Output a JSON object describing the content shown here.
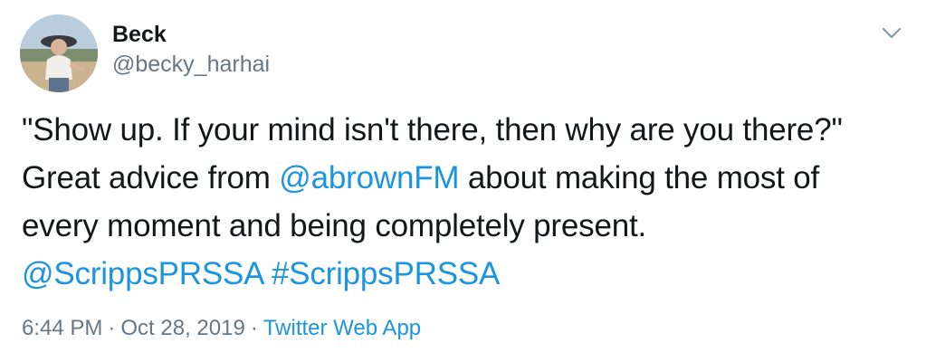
{
  "author": {
    "display_name": "Beck",
    "handle": "@becky_harhai"
  },
  "tweet": {
    "text_1": "\"Show up. If your mind isn't there, then why are you there?\" Great advice from ",
    "mention_1": "@abrownFM",
    "text_2": " about making the most of every moment and being completely present. ",
    "mention_2": "@ScrippsPRSSA",
    "text_3": " ",
    "hashtag_1": "#ScrippsPRSSA"
  },
  "meta": {
    "time": "6:44 PM",
    "separator": "·",
    "date": "Oct 28, 2019",
    "source": "Twitter Web App"
  },
  "icons": {
    "more": "chevron-down-icon"
  },
  "colors": {
    "link": "#1b95e0",
    "secondary_text": "#657786",
    "primary_text": "#14171a"
  }
}
